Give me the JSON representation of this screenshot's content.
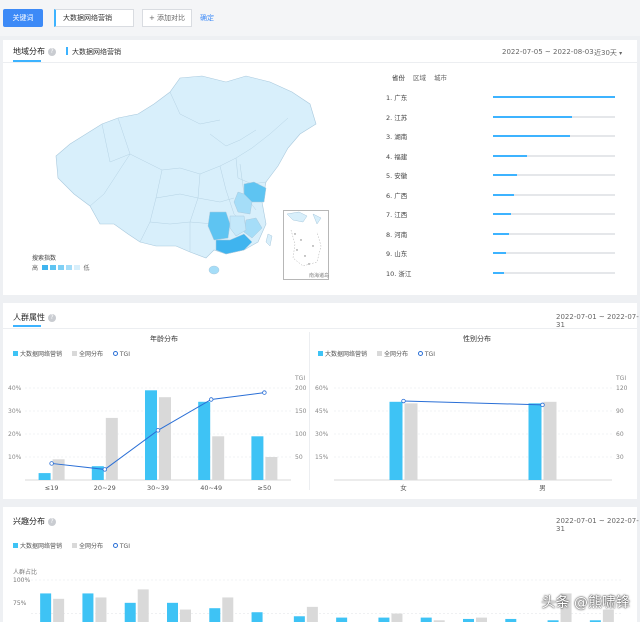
{
  "search": {
    "keyword_button": "关键词",
    "keyword_value": "大数据网络营销",
    "add_compare": "+ 添加对比",
    "confirm": "确定"
  },
  "region": {
    "tab": "地域分布",
    "series_name": "大数据网络营销",
    "date_range": "2022-07-05 ~ 2022-08-03",
    "period": "近30天",
    "heads": [
      "省份",
      "区域",
      "城市"
    ],
    "legend_title": "搜索指数",
    "legend_high": "高",
    "legend_low": "低",
    "inset_label": "南海诸岛",
    "ranking": [
      {
        "rank": "1.",
        "name": "广东",
        "value": 100
      },
      {
        "rank": "2.",
        "name": "江苏",
        "value": 65
      },
      {
        "rank": "3.",
        "name": "湖南",
        "value": 63
      },
      {
        "rank": "4.",
        "name": "福建",
        "value": 28
      },
      {
        "rank": "5.",
        "name": "安徽",
        "value": 20
      },
      {
        "rank": "6.",
        "name": "广西",
        "value": 17
      },
      {
        "rank": "7.",
        "name": "江西",
        "value": 15
      },
      {
        "rank": "8.",
        "name": "河南",
        "value": 13
      },
      {
        "rank": "9.",
        "name": "山东",
        "value": 11
      },
      {
        "rank": "10.",
        "name": "浙江",
        "value": 9
      }
    ],
    "colors": {
      "high": "#3fb4ef",
      "mid": "#7fd0f5",
      "low": "#d8effb"
    }
  },
  "crowd": {
    "tab": "人群属性",
    "date_range": "2022-07-01 ~ 2022-07-31",
    "legend": [
      "大数据网络营销",
      "全网分布",
      "TGI"
    ]
  },
  "interest": {
    "tab": "兴趣分布",
    "date_range": "2022-07-01 ~ 2022-07-31",
    "legend": [
      "大数据网络营销",
      "全网分布",
      "TGI"
    ],
    "y_label": "人群占比",
    "y_ticks": [
      "100%",
      "75%"
    ]
  },
  "chart_data": [
    {
      "type": "bar",
      "title": "年龄分布",
      "categories": [
        "≤19",
        "20~29",
        "30~39",
        "40~49",
        "≥50"
      ],
      "series": [
        {
          "name": "大数据网络营销",
          "values": [
            3,
            6,
            39,
            34,
            19
          ]
        },
        {
          "name": "全网分布",
          "values": [
            9,
            27,
            36,
            19,
            10
          ]
        },
        {
          "name": "TGI",
          "axis": "right",
          "values": [
            36,
            23,
            108,
            175,
            190
          ]
        }
      ],
      "ylim": [
        0,
        40
      ],
      "y_ticks": [
        "40%",
        "30%",
        "20%",
        "10%"
      ],
      "y2_label": "TGI",
      "y2lim": [
        0,
        200
      ],
      "y2_ticks": [
        "200",
        "150",
        "100",
        "50"
      ],
      "colors": {
        "primary": "#3ec3f5",
        "overall": "#d9d9d9",
        "tgi": "#2a6fd6"
      }
    },
    {
      "type": "bar",
      "title": "性别分布",
      "categories": [
        "女",
        "男"
      ],
      "series": [
        {
          "name": "大数据网络营销",
          "values": [
            51,
            50
          ]
        },
        {
          "name": "全网分布",
          "values": [
            50,
            51
          ]
        },
        {
          "name": "TGI",
          "axis": "right",
          "values": [
            103,
            98
          ]
        }
      ],
      "ylim": [
        0,
        60
      ],
      "y_ticks": [
        "60%",
        "45%",
        "30%",
        "15%"
      ],
      "y2_label": "TGI",
      "y2lim": [
        0,
        120
      ],
      "y2_ticks": [
        "120",
        "90",
        "60",
        "30"
      ],
      "colors": {
        "primary": "#3ec3f5",
        "overall": "#d9d9d9",
        "tgi": "#2a6fd6"
      }
    },
    {
      "type": "bar",
      "title": "",
      "categories": [
        "",
        "",
        "",
        "",
        "",
        "",
        "",
        "",
        "",
        "",
        "",
        "",
        "",
        ""
      ],
      "series": [
        {
          "name": "大数据网络营销",
          "values": [
            90,
            90,
            83,
            83,
            79,
            76,
            73,
            72,
            72,
            72,
            71,
            71,
            70,
            70
          ]
        },
        {
          "name": "全网分布",
          "values": [
            86,
            87,
            93,
            78,
            87,
            67,
            80,
            68,
            75,
            70,
            72,
            65,
            90,
            78
          ]
        }
      ],
      "ylim": [
        65,
        100
      ],
      "colors": {
        "primary": "#3ec3f5",
        "overall": "#d9d9d9"
      }
    }
  ],
  "watermark": "头条 @熊啸锋"
}
